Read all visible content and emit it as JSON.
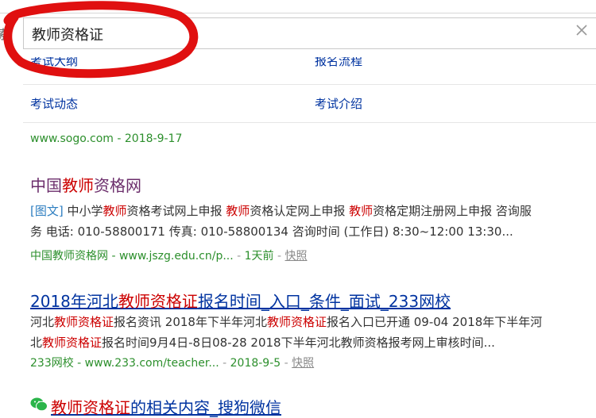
{
  "search": {
    "query": "教师资格证"
  },
  "sitelinks": {
    "row1_left": "考试大纲",
    "row1_right": "报名流程",
    "row2_left": "考试动态",
    "row2_right": "考试介绍"
  },
  "result0": {
    "domain": "www.sogo.com",
    "sep": " - ",
    "date": "2018-9-17"
  },
  "result1": {
    "title_pre": "中国",
    "title_em": "教师",
    "title_post": "资格网",
    "tag": "[图文]",
    "snip_a": " 中小学",
    "snip_b": "教师",
    "snip_c": "资格考试网上申报 ",
    "snip_d": "教师",
    "snip_e": "资格认定网上申报 ",
    "snip_f": "教师",
    "snip_g": "资格定期注册网上申报 咨询服",
    "snip_line2": "务 电话: 010-58800171 传真: 010-58800134 咨询时间 (工作日) 8:30~12:00 13:30...",
    "source": "中国教师资格网 - www.jszg.edu.cn/p...",
    "sep": " - ",
    "time": "1天前",
    "sep2": " - ",
    "snapshot": "快照"
  },
  "result2": {
    "title_pre": "2018年河北",
    "title_em": "教师资格证",
    "title_post": "报名时间_入口_条件_面试_233网校",
    "l1_a": "河北",
    "l1_b": "教师资格证",
    "l1_c": "报名资讯 2018年下半年河北",
    "l1_d": "教师资格证",
    "l1_e": "报名入口已开通 09-04 2018年下半年河",
    "l2_a": "北",
    "l2_b": "教师资格证",
    "l2_c": "报名时间9月4日-8日08-28 2018下半年河北教师资格报考网上审核时间...",
    "source": "233网校 - www.233.com/teacher...",
    "sep": " - ",
    "date": "2018-9-5",
    "sep2": " - ",
    "snapshot": "快照"
  },
  "result3": {
    "title_em": "教师资格证",
    "title_post": "的相关内容_搜狗微信"
  },
  "icons": {
    "clear": "close-icon",
    "wechat": "wechat-icon",
    "annotation": "red-hand-drawn-circle"
  },
  "colors": {
    "link": "#0033a0",
    "visited": "#6b2d6b",
    "highlight": "#cc0000",
    "url_green": "#2c8f2c",
    "annotation_red": "#e01010"
  }
}
